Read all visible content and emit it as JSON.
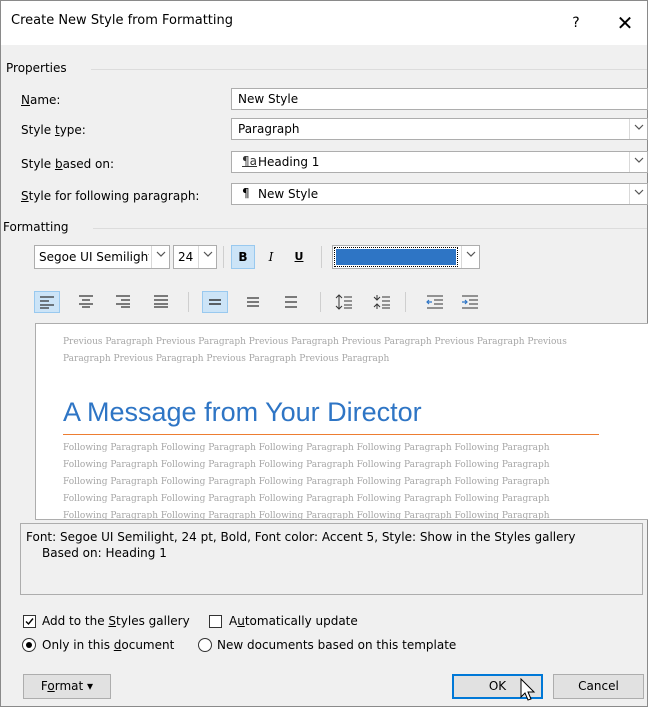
{
  "window": {
    "title": "Create New Style from Formatting",
    "help_label": "?",
    "close_label": "✕"
  },
  "properties": {
    "section_label": "Properties",
    "name_label": "Name:",
    "name_value": "New Style",
    "style_type_label": "Style type:",
    "style_type_value": "Paragraph",
    "based_on_label": "Style based on:",
    "based_on_value": "Heading 1",
    "based_on_icon": "linked-paragraph-style-icon",
    "following_label": "Style for following paragraph:",
    "following_value": "New Style",
    "following_icon": "paragraph-mark-icon"
  },
  "formatting": {
    "section_label": "Formatting",
    "font_value": "Segoe UI Semilight",
    "size_value": "24",
    "bold_label": "B",
    "italic_label": "I",
    "underline_label": "U",
    "font_color": "#2e75c5",
    "bold_active": true,
    "align_active": "left",
    "spacing_active": "single"
  },
  "preview": {
    "previous_text": "Previous Paragraph Previous Paragraph Previous Paragraph Previous Paragraph Previous Paragraph Previous Paragraph Previous Paragraph Previous Paragraph Previous Paragraph",
    "heading_text": "A Message from Your Director",
    "following_lines": [
      "Following Paragraph Following Paragraph Following Paragraph Following Paragraph Following Paragraph",
      "Following Paragraph Following Paragraph Following Paragraph Following Paragraph Following Paragraph",
      "Following Paragraph Following Paragraph Following Paragraph Following Paragraph Following Paragraph",
      "Following Paragraph Following Paragraph Following Paragraph Following Paragraph Following Paragraph",
      "Following Paragraph Following Paragraph Following Paragraph Following Paragraph Following Paragraph"
    ],
    "heading_color": "#2e75c5",
    "rule_color": "#ed7d31"
  },
  "description": {
    "line1": "Font: Segoe UI Semilight, 24 pt, Bold, Font color: Accent 5, Style: Show in the Styles gallery",
    "line2": "Based on: Heading 1"
  },
  "options": {
    "add_to_gallery_label_pre": "Add to the ",
    "add_to_gallery_label_key": "S",
    "add_to_gallery_label_post": "tyles gallery",
    "add_to_gallery_checked": true,
    "auto_update_label_pre": "A",
    "auto_update_label_key": "u",
    "auto_update_label_post": "tomatically update",
    "auto_update_checked": false,
    "only_doc_label_pre": "Only in this ",
    "only_doc_label_key": "d",
    "only_doc_label_post": "ocument",
    "only_doc_selected": true,
    "new_docs_label": "New documents based on this template",
    "new_docs_selected": false
  },
  "buttons": {
    "format_label_pre": "F",
    "format_label_key": "o",
    "format_label_post": "rmat",
    "format_caret": "▾",
    "ok_label": "OK",
    "cancel_label": "Cancel"
  }
}
